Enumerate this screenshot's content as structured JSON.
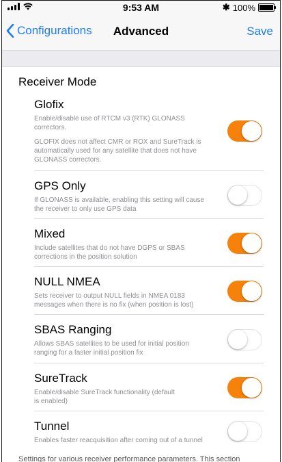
{
  "status_bar": {
    "time": "9:53 AM",
    "bluetooth": "✱",
    "battery": "100%"
  },
  "nav": {
    "back_label": "Configurations",
    "title": "Advanced",
    "save_label": "Save"
  },
  "section_header": "Receiver Mode",
  "settings": [
    {
      "title": "Glofix",
      "desc": [
        "Enable/disable use of RTCM v3 (RTK) GLONASS",
        "correctors."
      ],
      "desc2": [
        "GLOFIX does not affect CMR or ROX and SureTrack is",
        "automatically used for any satellite that does not have",
        "GLONASS correctors."
      ],
      "on": true
    },
    {
      "title": "GPS Only",
      "desc": [
        "If GLONASS is available, enabling this setting will cause",
        "the receiver to only use GPS data"
      ],
      "on": false
    },
    {
      "title": "Mixed",
      "desc": [
        "Include satellites that do not have DGPS or SBAS",
        "corrections in the position solution"
      ],
      "on": true
    },
    {
      "title": "NULL NMEA",
      "desc": [
        "Sets receiver to output NULL fields in NMEA 0183",
        "messages when there is no fix (when position is lost)"
      ],
      "on": true
    },
    {
      "title": "SBAS Ranging",
      "desc": [
        "Allows SBAS satellites to be used for initial position",
        "ranging for a faster initial position fix"
      ],
      "on": false
    },
    {
      "title": "SureTrack",
      "desc": [
        "Enable/disable SureTrack functionality (default",
        "is enabled)"
      ],
      "on": true
    },
    {
      "title": "Tunnel",
      "desc": [
        "Enables faster reacquisition after coming out of a tunnel"
      ],
      "on": false
    }
  ],
  "footer": "Settings for various receiver performance parameters.  This section",
  "colors": {
    "accent": "#f6820c",
    "link": "#1e7cf5"
  }
}
